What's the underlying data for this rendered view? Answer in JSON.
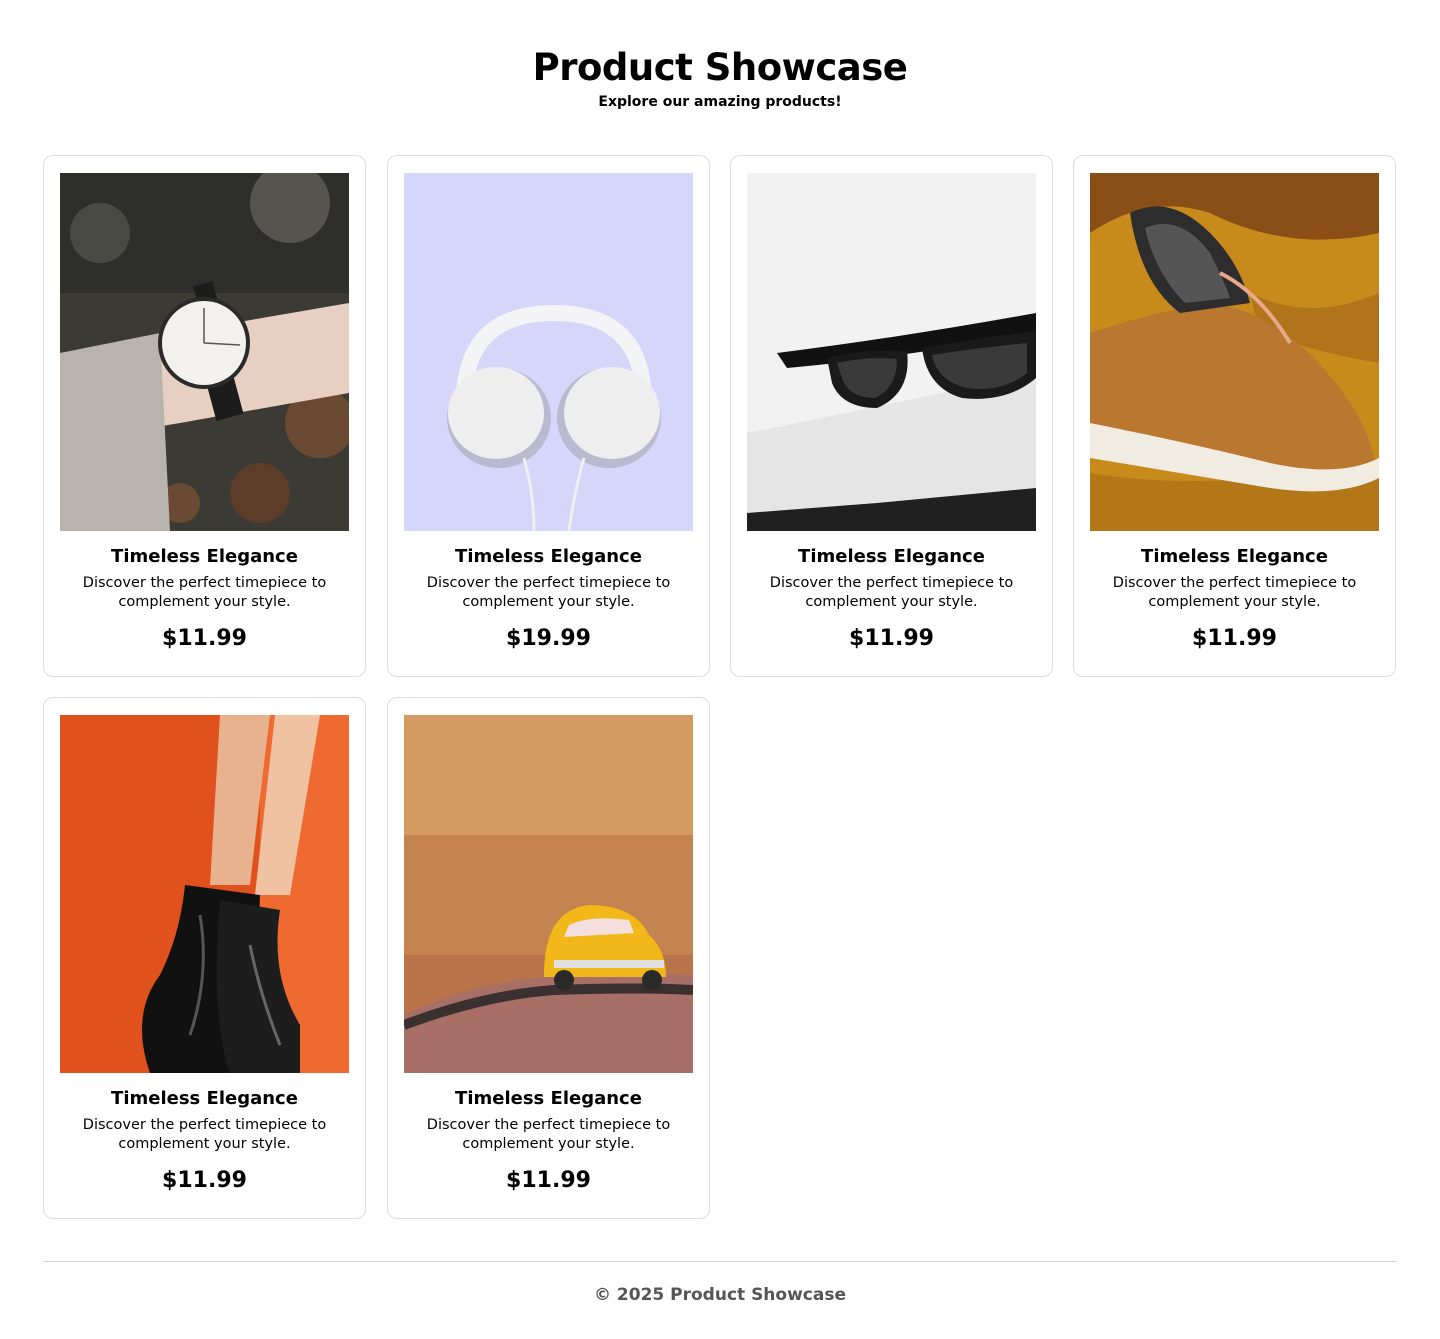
{
  "header": {
    "title": "Product Showcase",
    "subtitle": "Explore our amazing products!"
  },
  "products": [
    {
      "title": "Timeless Elegance",
      "description": "Discover the perfect timepiece to complement your style.",
      "price": "$11.99",
      "image": "wristwatch-photo"
    },
    {
      "title": "Timeless Elegance",
      "description": "Discover the perfect timepiece to complement your style.",
      "price": "$19.99",
      "image": "headphones-photo"
    },
    {
      "title": "Timeless Elegance",
      "description": "Discover the perfect timepiece to complement your style.",
      "price": "$11.99",
      "image": "sunglasses-photo"
    },
    {
      "title": "Timeless Elegance",
      "description": "Discover the perfect timepiece to complement your style.",
      "price": "$11.99",
      "image": "sneaker-photo"
    },
    {
      "title": "Timeless Elegance",
      "description": "Discover the perfect timepiece to complement your style.",
      "price": "$11.99",
      "image": "ankle-boots-photo"
    },
    {
      "title": "Timeless Elegance",
      "description": "Discover the perfect timepiece to complement your style.",
      "price": "$11.99",
      "image": "toy-car-photo"
    }
  ],
  "footer": {
    "copyright": "© 2025 Product Showcase"
  }
}
